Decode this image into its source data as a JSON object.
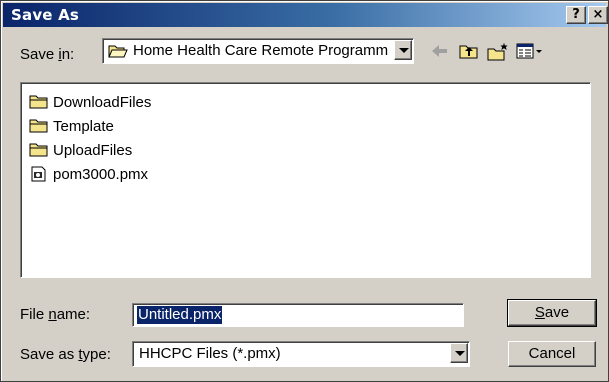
{
  "window": {
    "title": "Save As",
    "help_glyph": "?",
    "close_glyph": "×"
  },
  "save_in": {
    "label_pre": "Save ",
    "label_key": "i",
    "label_post": "n:",
    "value": "Home Health Care Remote Programm",
    "icon": "folder-open-icon"
  },
  "toolbar": {
    "icons": [
      "back-arrow-icon",
      "up-one-level-icon",
      "new-folder-icon",
      "view-menu-icon"
    ]
  },
  "files": [
    {
      "name": "DownloadFiles",
      "icon": "folder-icon"
    },
    {
      "name": "Template",
      "icon": "folder-icon"
    },
    {
      "name": "UploadFiles",
      "icon": "folder-icon"
    },
    {
      "name": "pom3000.pmx",
      "icon": "pmx-file-icon"
    }
  ],
  "file_name": {
    "label_pre": "File ",
    "label_key": "n",
    "label_post": "ame:",
    "value": "Untitled.pmx"
  },
  "save_as_type": {
    "label_pre": "Save as ",
    "label_key": "t",
    "label_post": "ype:",
    "value": "HHCPC Files (*.pmx)"
  },
  "buttons": {
    "save_key": "S",
    "save_rest": "ave",
    "cancel": "Cancel"
  },
  "colors": {
    "title_start": "#0a246a",
    "title_end": "#a6caf0",
    "face": "#d4d0c8",
    "selection": "#0a246a",
    "folder_fill": "#f4e48c"
  }
}
